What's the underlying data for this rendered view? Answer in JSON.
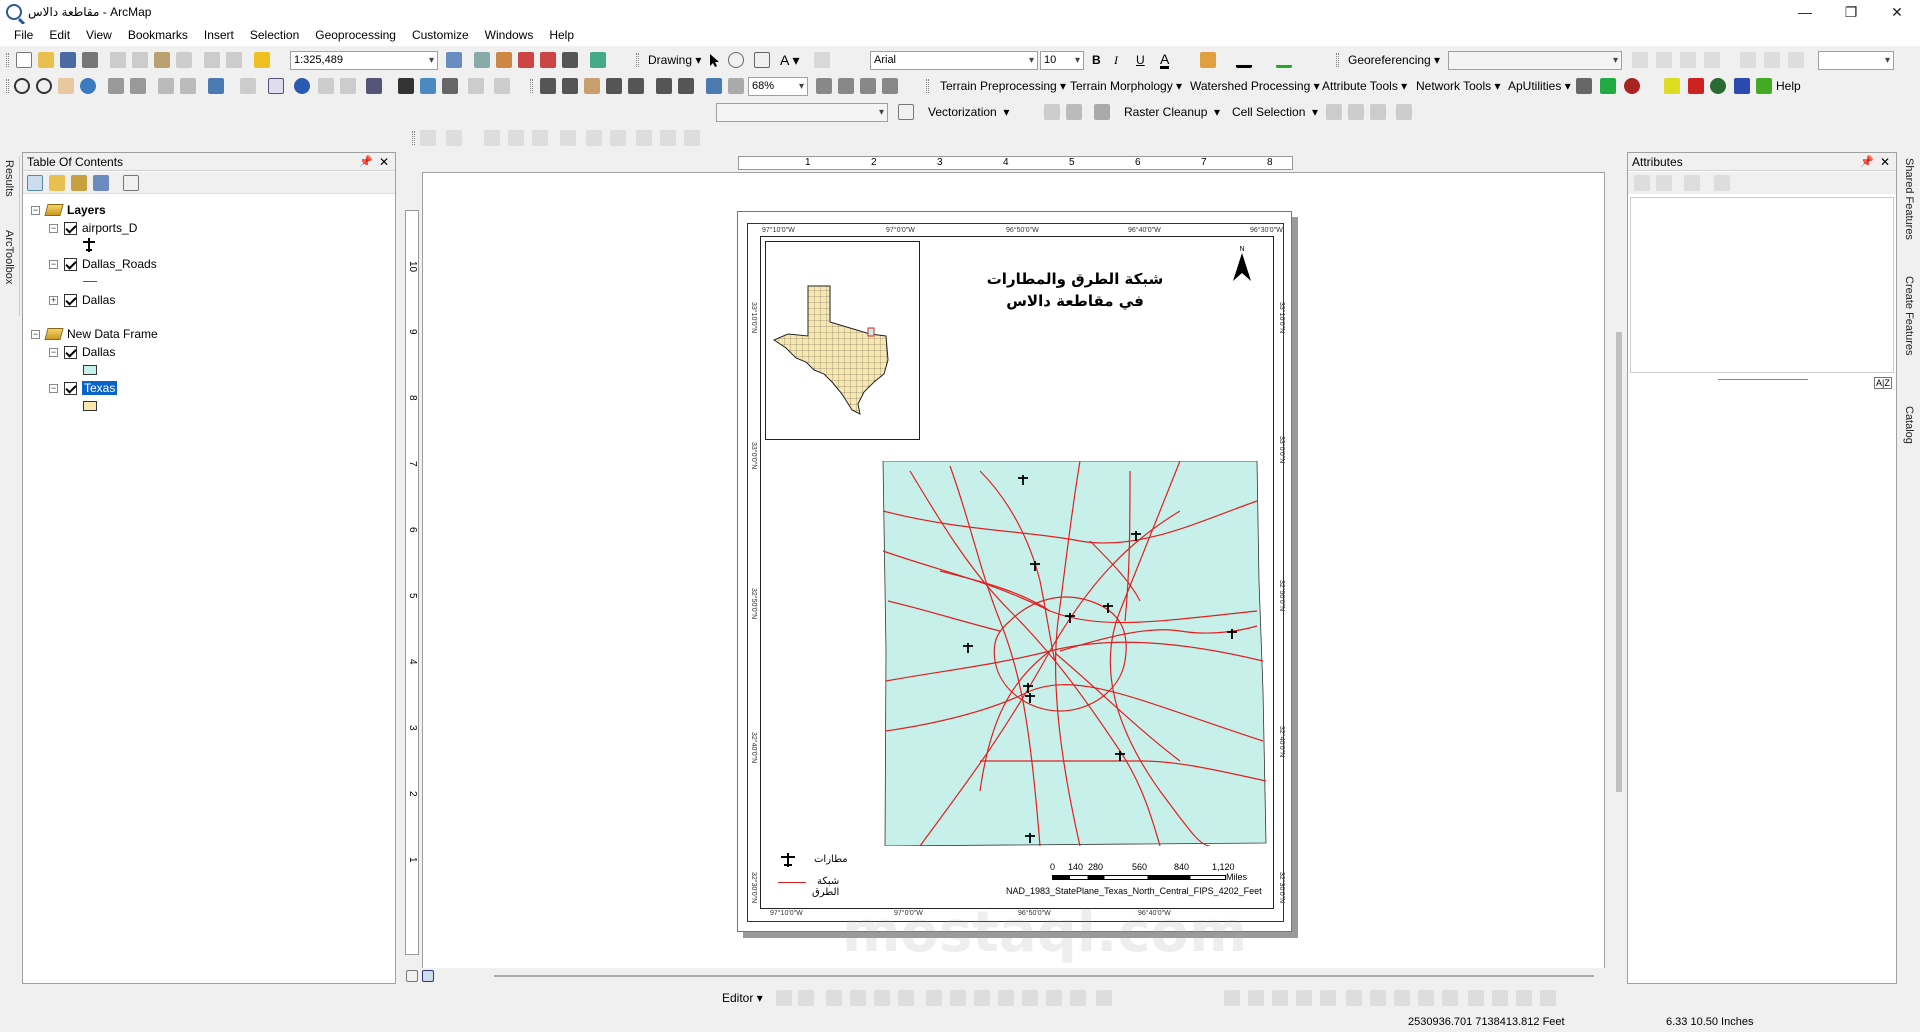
{
  "window": {
    "title": "مقاطعة دالاس - ArcMap",
    "minimize": "—",
    "maximize": "❐",
    "close": "✕"
  },
  "menu": [
    "File",
    "Edit",
    "View",
    "Bookmarks",
    "Insert",
    "Selection",
    "Geoprocessing",
    "Customize",
    "Windows",
    "Help"
  ],
  "toolbar1": {
    "scale": "1:325,489",
    "drawing": "Drawing",
    "font": "Arial",
    "font_size": "10",
    "bold": "B",
    "italic": "I",
    "underline": "U",
    "font_color": "A",
    "georeferencing": "Georeferencing"
  },
  "toolbar2": {
    "zoom": "68%",
    "menus": [
      "Terrain Preprocessing",
      "Terrain Morphology",
      "Watershed Processing",
      "Attribute Tools",
      "Network Tools",
      "ApUtilities"
    ],
    "help": "Help"
  },
  "toolbar3": {
    "vectorization": "Vectorization",
    "raster_cleanup": "Raster Cleanup",
    "cell_selection": "Cell Selection"
  },
  "toc": {
    "title": "Table Of Contents",
    "frames": [
      {
        "name": "Layers",
        "layers": [
          "airports_D",
          "Dallas_Roads",
          "Dallas"
        ]
      },
      {
        "name": "New Data Frame",
        "layers": [
          "Dallas",
          "Texas"
        ]
      }
    ]
  },
  "attributes": {
    "title": "Attributes"
  },
  "side_tabs_left": [
    "Results",
    "ArcToolbox"
  ],
  "side_tabs_right": [
    "Shared Features",
    "Create Features",
    "Catalog"
  ],
  "ruler_h": [
    "1",
    "2",
    "3",
    "4",
    "5",
    "6",
    "7",
    "8"
  ],
  "ruler_v": [
    "10",
    "9",
    "8",
    "7",
    "6",
    "5",
    "4",
    "3",
    "2",
    "1"
  ],
  "map": {
    "title_line1": "شبكة الطرق والمطارات",
    "title_line2": "في مقاطعة دالاس",
    "north": "N",
    "graticule_top": [
      "97°10'0\"W",
      "97°0'0\"W",
      "96°50'0\"W",
      "96°40'0\"W",
      "96°30'0\"W"
    ],
    "graticule_bottom": [
      "97°10'0\"W",
      "97°0'0\"W",
      "96°50'0\"W",
      "96°40'0\"W"
    ],
    "graticule_left": [
      "33°10'0\"N",
      "33°0'0\"N",
      "32°50'0\"N",
      "32°40'0\"N",
      "32°30'0\"N"
    ],
    "graticule_right": [
      "33°10'0\"N",
      "33°0'0\"N",
      "32°50'0\"N",
      "32°40'0\"N",
      "32°30'0\"N"
    ],
    "legend": {
      "airports": "مطارات",
      "roads": "شبكة الطرق"
    },
    "scale": {
      "ticks": [
        "0",
        "140",
        "280",
        "560",
        "840",
        "1,120"
      ],
      "unit": "Miles"
    },
    "projection": "NAD_1983_StatePlane_Texas_North_Central_FIPS_4202_Feet",
    "colors": {
      "county_fill": "#c8f0ea",
      "roads": "#e02020",
      "texas_fill": "#f8e8b0"
    }
  },
  "editor": {
    "label": "Editor"
  },
  "status": {
    "coords": "2530936.701  7138413.812 Feet",
    "page": "6.33  10.50 Inches"
  }
}
